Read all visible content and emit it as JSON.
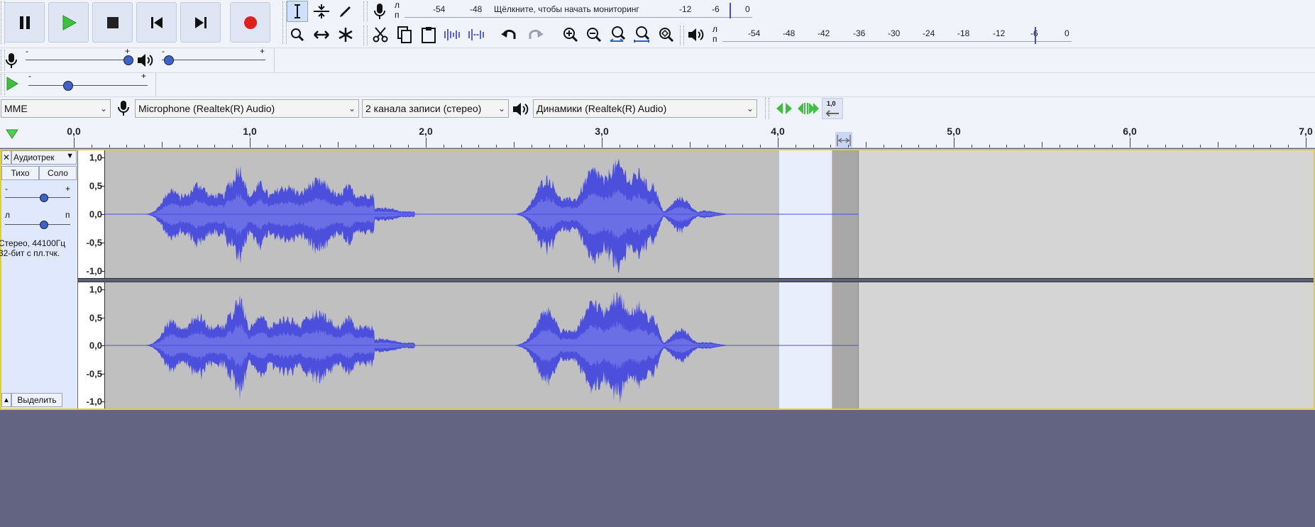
{
  "transport": {
    "buttons": [
      {
        "name": "pause-button",
        "icon": "pause-icon"
      },
      {
        "name": "play-button",
        "icon": "play-icon"
      },
      {
        "name": "stop-button",
        "icon": "stop-icon"
      },
      {
        "name": "skip-start-button",
        "icon": "skip-start-icon"
      },
      {
        "name": "skip-end-button",
        "icon": "skip-end-icon"
      },
      {
        "name": "record-button",
        "icon": "record-icon"
      }
    ]
  },
  "recording_meter": {
    "channels": [
      "л",
      "п"
    ],
    "ticks": [
      "-54",
      "-48",
      "-12",
      "-6",
      "0"
    ],
    "prompt": "Щёлкните, чтобы начать мониторинг"
  },
  "playback_meter": {
    "channels": [
      "л",
      "п"
    ],
    "ticks": [
      "-54",
      "-48",
      "-42",
      "-36",
      "-30",
      "-24",
      "-18",
      "-12",
      "-6",
      "0"
    ]
  },
  "mixer": {
    "rec_slider_min": "-",
    "rec_slider_max": "+",
    "play_slider_min": "-",
    "play_slider_max": "+"
  },
  "speed": {
    "min": "-",
    "max": "+"
  },
  "device": {
    "host": "MME",
    "recording_device": "Microphone (Realtek(R) Audio)",
    "channels": "2  канала записи (стерео)",
    "playback_device": "Динамики (Realtek(R) Audio)",
    "rate_label": "1,0"
  },
  "ruler": {
    "labels": [
      "0,0",
      "1,0",
      "2,0",
      "3,0",
      "4,0",
      "5,0",
      "6,0",
      "7,0"
    ]
  },
  "track": {
    "name": "Аудиотрек",
    "mute": "Тихо",
    "solo": "Соло",
    "gain_min": "-",
    "gain_max": "+",
    "pan_left": "л",
    "pan_right": "п",
    "info_line1": "Стерео, 44100Гц",
    "info_line2": "32-бит с пл.тчк.",
    "select": "Выделить",
    "scale_labels": [
      "1,0",
      "0,5",
      "0,0",
      "-0,5",
      "-1,0"
    ],
    "selection_start_sec": 4.0,
    "selection_end_sec": 4.3,
    "audio_end_sec": 4.45,
    "gain_fraction": 0.6,
    "pan_fraction": 0.6
  },
  "colors": {
    "wave": "#4b4fdc",
    "wave_rms": "#6b6fe6",
    "selected_bg": "#c0c0c0",
    "unselected_bg": "#d5d5d5",
    "toolbar": "#f0f3fa",
    "track_frame": "#e2d21a"
  }
}
